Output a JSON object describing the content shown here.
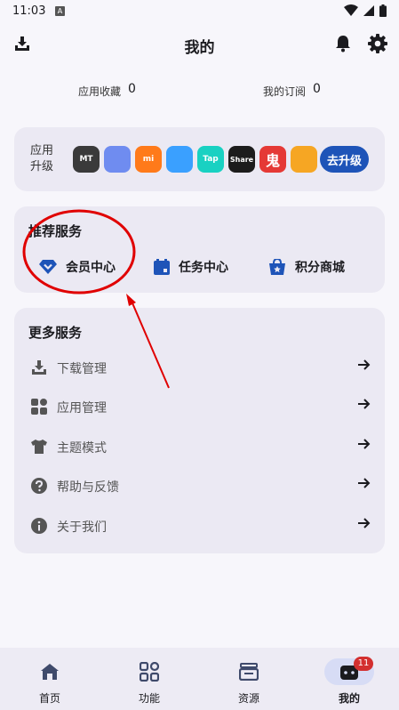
{
  "status_bar": {
    "time": "11:03",
    "a_badge": "A"
  },
  "header": {
    "title": "我的",
    "download_icon": "download-icon",
    "bell_icon": "bell-icon",
    "settings_icon": "gear-icon"
  },
  "stats": {
    "favorites_label": "应用收藏",
    "favorites_value": "0",
    "subscriptions_label": "我的订阅",
    "subscriptions_value": "0"
  },
  "upgrade": {
    "label": "应用升级",
    "apps": [
      {
        "name": "MT",
        "text": "MT",
        "color": "#3a3a3a"
      },
      {
        "name": "gallery",
        "text": "",
        "color": "#6f8cf0"
      },
      {
        "name": "mi-store",
        "text": "mi",
        "color": "#ff7a1a"
      },
      {
        "name": "browser",
        "text": "",
        "color": "#3aa0ff"
      },
      {
        "name": "taptap",
        "text": "Tap",
        "color": "#19d1c2"
      },
      {
        "name": "share",
        "text": "Share",
        "color": "#1c1c1c"
      },
      {
        "name": "red-app",
        "text": "鬼",
        "color": "#e53935"
      },
      {
        "name": "partial-app",
        "text": "",
        "color": "#f6a623"
      }
    ],
    "button": "去升级"
  },
  "recommended": {
    "title": "推荐服务",
    "items": [
      {
        "label": "会员中心",
        "icon": "diamond-icon"
      },
      {
        "label": "任务中心",
        "icon": "calendar-icon"
      },
      {
        "label": "积分商城",
        "icon": "shop-icon"
      }
    ]
  },
  "more": {
    "title": "更多服务",
    "items": [
      {
        "label": "下载管理",
        "icon": "download-manage-icon"
      },
      {
        "label": "应用管理",
        "icon": "apps-grid-icon"
      },
      {
        "label": "主题模式",
        "icon": "tshirt-icon"
      },
      {
        "label": "帮助与反馈",
        "icon": "help-icon"
      },
      {
        "label": "关于我们",
        "icon": "info-icon"
      }
    ]
  },
  "nav": {
    "items": [
      {
        "label": "首页",
        "icon": "home-icon"
      },
      {
        "label": "功能",
        "icon": "function-icon"
      },
      {
        "label": "资源",
        "icon": "resource-icon"
      },
      {
        "label": "我的",
        "icon": "profile-icon",
        "badge": "11",
        "active": true
      }
    ]
  },
  "colors": {
    "accent": "#1e54b8",
    "annotation_red": "#e00000",
    "badge": "#d32f2f"
  }
}
